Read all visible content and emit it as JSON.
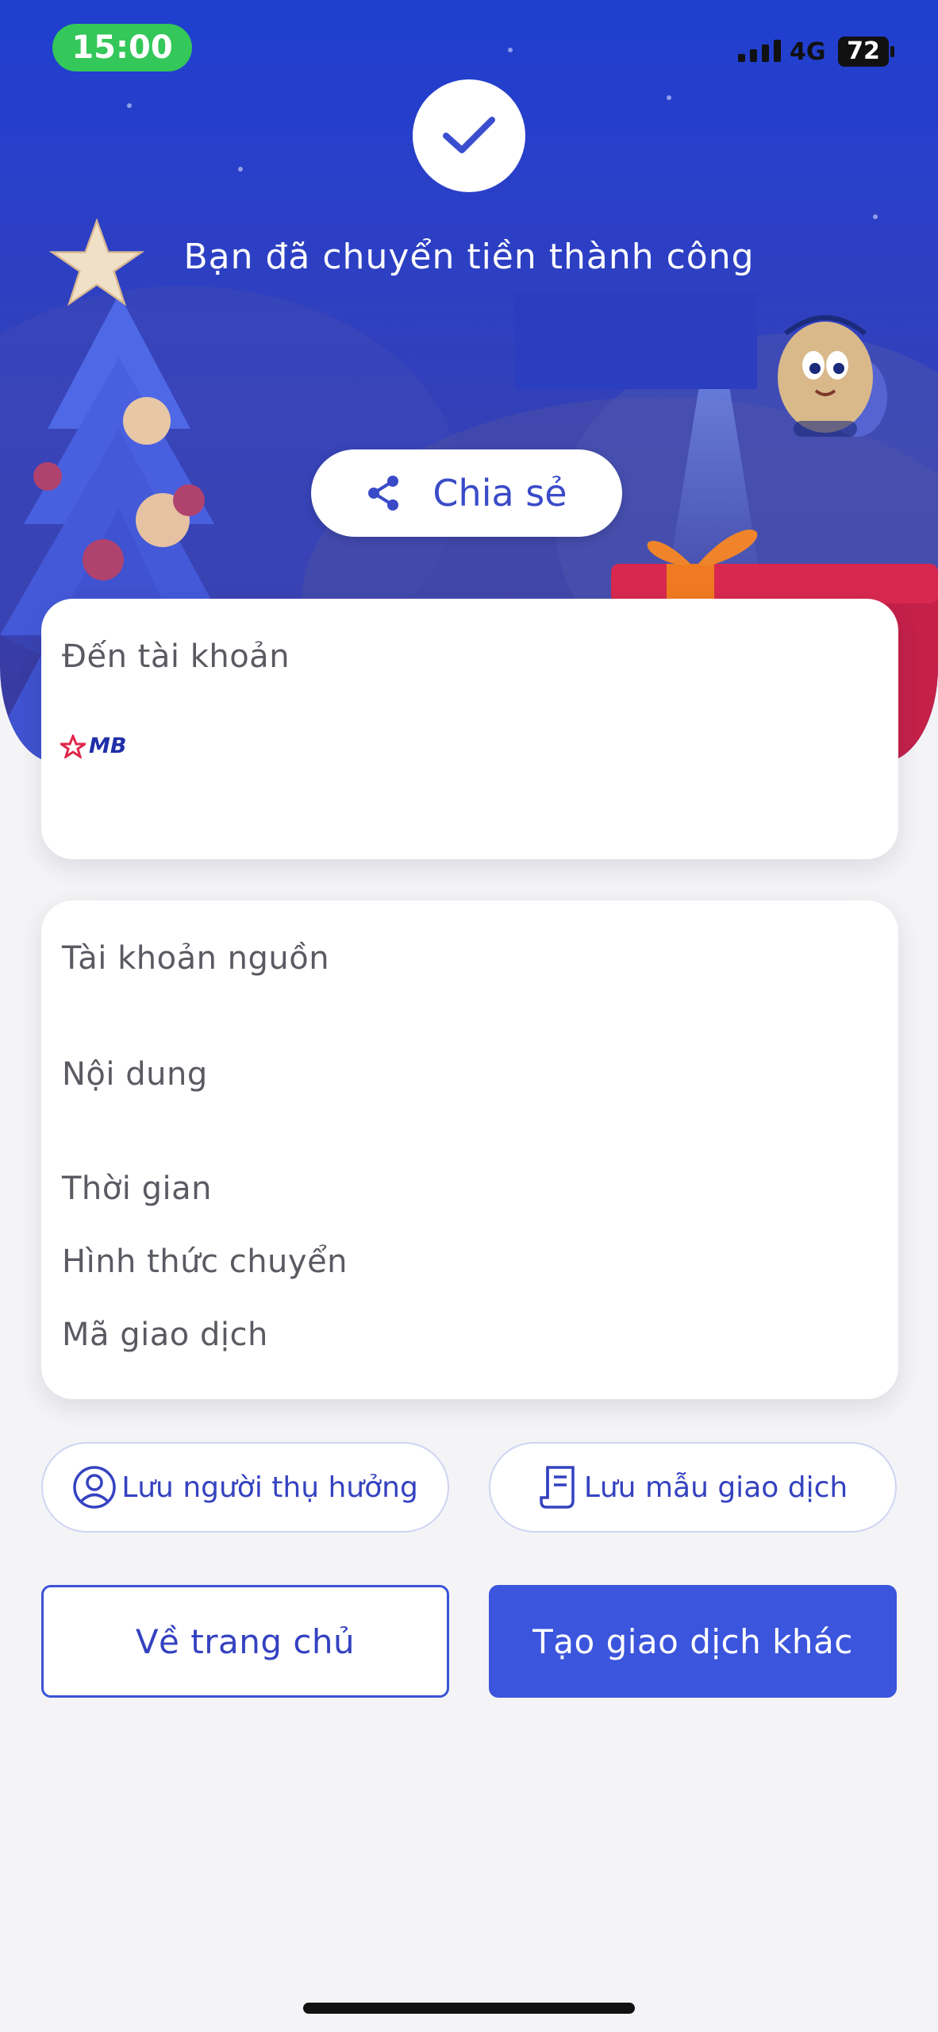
{
  "status_bar": {
    "time": "15:00",
    "network": "4G",
    "battery": "72"
  },
  "header": {
    "success_message": "Bạn đã chuyển tiền thành công",
    "share_label": "Chia sẻ"
  },
  "recipient_card": {
    "label": "Đến tài khoản",
    "bank_name": "MB"
  },
  "details_card": {
    "labels": [
      "Tài khoản nguồn",
      "Nội dung",
      "Thời gian",
      "Hình thức chuyển",
      "Mã giao dịch"
    ]
  },
  "actions": {
    "save_beneficiary": "Lưu người thụ hưởng",
    "save_template": "Lưu mẫu giao dịch",
    "home": "Về trang chủ",
    "new_transaction": "Tạo giao dịch khác"
  },
  "icons": {
    "check": "check-icon",
    "share": "share-icon",
    "user": "user-circle-icon",
    "template": "receipt-icon"
  },
  "colors": {
    "accent": "#3b55dc",
    "hero_top": "#1f3fcf",
    "status_green": "#34c759"
  }
}
